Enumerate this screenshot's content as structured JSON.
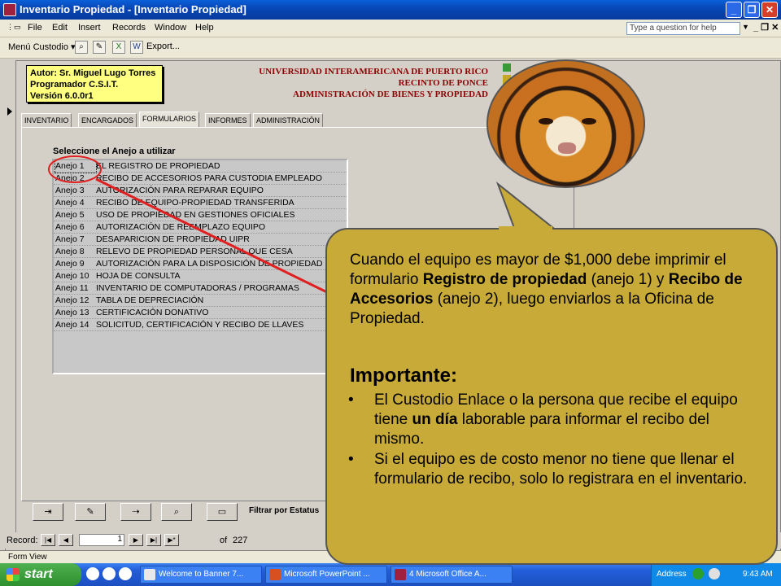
{
  "window": {
    "title": "Inventario Propiedad - [Inventario Propiedad]",
    "minimize": "_",
    "restore": "❐",
    "close": "✕"
  },
  "menu": {
    "items": [
      "File",
      "Edit",
      "Insert",
      "Records",
      "Window",
      "Help"
    ],
    "ask_placeholder": "Type a question for help",
    "ask_arrow": "▼",
    "doc_close": "_ ❐ ✕"
  },
  "toolbar": {
    "menu_label": "Menú Custodio ▾",
    "export_label": "Export...",
    "icons": [
      "binoculars-icon",
      "edit-icon",
      "excel-icon",
      "word-icon"
    ]
  },
  "header": {
    "author_lines": [
      "Autor:  Sr. Miguel Lugo Torres",
      "Programador C.S.I.T.",
      "Versión 6.0.0r1"
    ],
    "university_lines": [
      "UNIVERSIDAD INTERAMERICANA DE PUERTO RICO",
      "RECINTO DE PONCE",
      "ADMINISTRACIÓN DE BIENES Y PROPIEDAD"
    ]
  },
  "tabs": [
    "INVENTARIO",
    "ENCARGADOS",
    "FORMULARIOS",
    "INFORMES",
    "ADMINISTRACIÓN"
  ],
  "active_tab": "FORMULARIOS",
  "anejos": {
    "label": "Seleccione el Anejo a utilizar",
    "rows": [
      {
        "id": "Anejo 1",
        "name": "EL REGISTRO DE PROPIEDAD"
      },
      {
        "id": "Anejo 2",
        "name": "RECIBO DE ACCESORIOS PARA CUSTODIA EMPLEADO"
      },
      {
        "id": "Anejo 3",
        "name": "AUTORIZACIÓN PARA REPARAR EQUIPO"
      },
      {
        "id": "Anejo 4",
        "name": "RECIBO DE EQUIPO-PROPIEDAD TRANSFERIDA"
      },
      {
        "id": "Anejo 5",
        "name": "USO DE PROPIEDAD EN GESTIONES OFICIALES"
      },
      {
        "id": "Anejo 6",
        "name": "AUTORIZACIÓN DE REEMPLAZO EQUIPO"
      },
      {
        "id": "Anejo 7",
        "name": "DESAPARICION DE PROPIEDAD UIPR"
      },
      {
        "id": "Anejo 8",
        "name": "RELEVO DE PROPIEDAD PERSONAL QUE CESA"
      },
      {
        "id": "Anejo 9",
        "name": "AUTORIZACIÓN PARA LA DISPOSICIÓN DE PROPIEDAD"
      },
      {
        "id": "Anejo 10",
        "name": "HOJA DE CONSULTA"
      },
      {
        "id": "Anejo 11",
        "name": "INVENTARIO DE COMPUTADORAS / PROGRAMAS"
      },
      {
        "id": "Anejo 12",
        "name": "TABLA DE DEPRECIACIÓN"
      },
      {
        "id": "Anejo 13",
        "name": "CERTIFICACIÓN DONATIVO"
      },
      {
        "id": "Anejo 14",
        "name": "SOLICITUD, CERTIFICACIÓN Y RECIBO DE LLAVES"
      }
    ]
  },
  "bottom_buttons": [
    "⇥",
    "✎",
    "⇢",
    "⌕",
    "▭"
  ],
  "filtrar_label": "Filtrar por Estatus",
  "record_nav": {
    "label": "Record:",
    "current": "1",
    "of_label": "of",
    "total": "227",
    "first": "|◀",
    "prev": "◀",
    "next": "▶",
    "last": "▶|",
    "new": "▶*"
  },
  "status": {
    "text": "Form View"
  },
  "taskbar": {
    "start": "start",
    "items": [
      "Welcome to Banner 7...",
      "Microsoft PowerPoint ...",
      "4 Microsoft Office A..."
    ],
    "address_label": "Address",
    "clock": "9:43 AM"
  },
  "callout": {
    "intro_parts": [
      "Cuando el equipo es mayor de $1,000 debe imprimir el formulario ",
      "Registro de propiedad",
      " (anejo 1) y ",
      "Recibo de Accesorios",
      " (anejo 2), luego enviarlos a la Oficina de Propiedad."
    ],
    "important": "Importante:",
    "bullet1_parts": [
      "El Custodio Enlace o la persona que recibe el equipo tiene ",
      "un día",
      " laborable para informar el recibo del mismo."
    ],
    "bullet2": "Si el equipo es de costo menor no tiene que llenar el formulario de recibo, solo lo registrara en el inventario."
  }
}
